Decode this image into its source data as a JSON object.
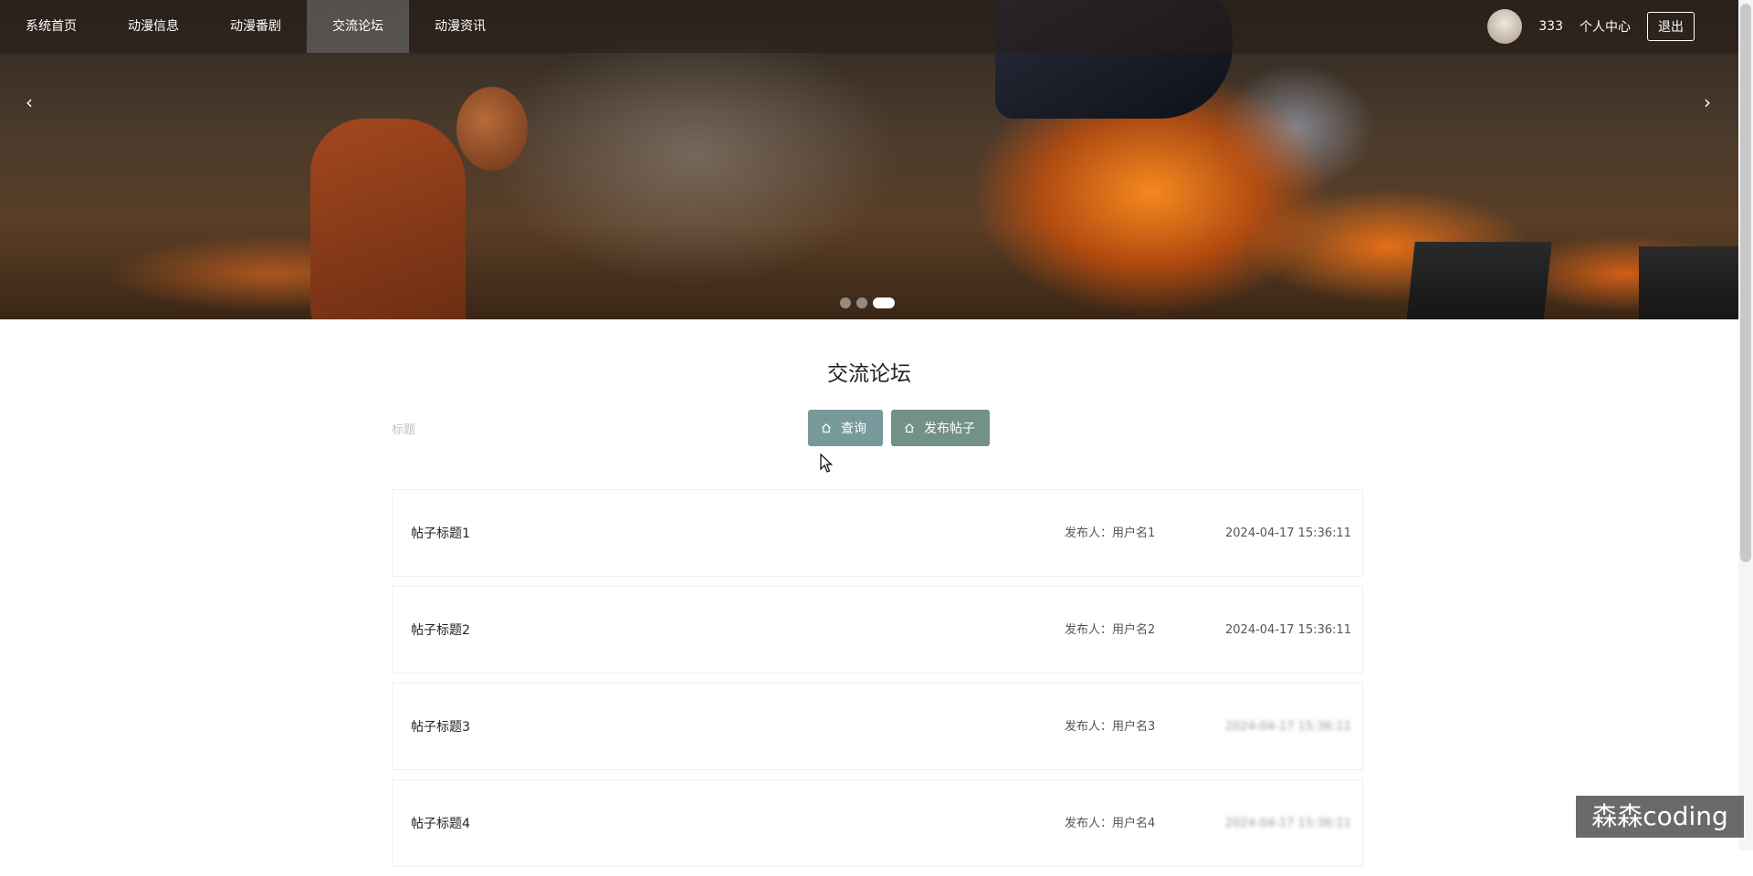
{
  "nav": {
    "items": [
      {
        "label": "系统首页",
        "active": false
      },
      {
        "label": "动漫信息",
        "active": false
      },
      {
        "label": "动漫番剧",
        "active": false
      },
      {
        "label": "交流论坛",
        "active": true
      },
      {
        "label": "动漫资讯",
        "active": false
      }
    ],
    "user_name": "333",
    "profile_label": "个人中心",
    "logout_label": "退出"
  },
  "carousel": {
    "prev_glyph": "‹",
    "next_glyph": "›",
    "slide_count": 3,
    "active_slide": 3
  },
  "forum": {
    "title": "交流论坛",
    "search_label": "标题",
    "search_value": "",
    "query_button": "查询",
    "post_button": "发布帖子"
  },
  "posts": [
    {
      "title": "帖子标题1",
      "author_label": "发布人：",
      "author": "用户名1",
      "time": "2024-04-17 15:36:11"
    },
    {
      "title": "帖子标题2",
      "author_label": "发布人：",
      "author": "用户名2",
      "time": "2024-04-17 15:36:11"
    },
    {
      "title": "帖子标题3",
      "author_label": "发布人：",
      "author": "用户名3",
      "time": "2024-04-17 15:36:11"
    },
    {
      "title": "帖子标题4",
      "author_label": "发布人：",
      "author": "用户名4",
      "time": "2024-04-17 15:36:11"
    }
  ],
  "watermark": "森森coding",
  "colors": {
    "query_button": "#78999c",
    "post_button": "#739187",
    "nav_active": "#7a7a7a"
  }
}
